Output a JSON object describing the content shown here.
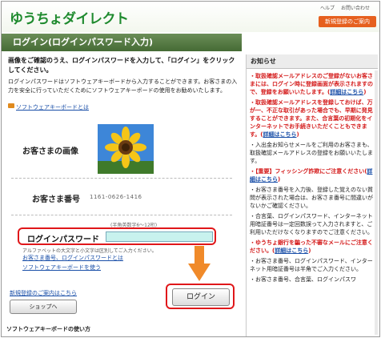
{
  "header": {
    "logo_text": "ゆうちょダイレクト",
    "util_links": [
      "ヘルプ",
      "お問い合わせ"
    ],
    "new_register": "新規登録のご案内"
  },
  "title": "ログイン(ログインパスワード入力)",
  "instructions": {
    "line1": "画像をご確認のうえ、ログインパスワードを入力して、「ログイン」をクリックしてください。",
    "line2": "ログインパスワードはソフトウェアキーボードから入力することができます。お客さまの入力を安全に行っていただくためにソフトウェアキーボードの使用をお勧めいたします。",
    "kb_link": "ソフトウェアキーボードとは"
  },
  "form": {
    "image_label": "お客さまの画像",
    "number_label": "お客さま番号",
    "number_value": "1161-0626-1416",
    "hint": "(半角英数字6〜12桁)",
    "password_label": "ログインパスワード",
    "note": "アルファベットの大文字と小文字は区別してご入力ください。",
    "forgot_link": "お客さま番号、ログインパスワードとは",
    "kb_use_link": "ソフトウェアキーボードを使う",
    "login_button": "ログイン"
  },
  "bottom": {
    "new_link": "新規登録のご案内はこちら",
    "shop_button": "ショップへ",
    "kb_howto": "ソフトウェアキーボードの使い方"
  },
  "sidebar": {
    "title": "お知らせ",
    "items": [
      {
        "text": "取扱確認メールアドレスのご登録がないお客さまには、ログイン時に登録画面が表示されますので、登録をお願いいたします。(",
        "more": "詳細はこちら",
        "tail": ")",
        "style": "red"
      },
      {
        "text": "取扱確認メールアドレスを登録しておけば、万が一、不正な取引があった場合でも、早期に発見することができます。また、合言葉の初期化をインターネットでお手続きいただくこともできます。(",
        "more": "詳細はこちら",
        "tail": ")",
        "style": "red"
      },
      {
        "text": "入出金お知らせメールをご利用のお客さまも、取扱確認メールアドレスの登録をお願いいたします。",
        "more": "",
        "tail": "",
        "style": "blk"
      },
      {
        "text": "【重要】フィッシング詐欺にご注意ください(",
        "more": "詳細はこちら",
        "tail": ")",
        "style": "red"
      },
      {
        "text": "お客さま番号を入力後、登録した覚えのない質問が表示された場合は、お客さま番号に間違いがないかご確認ください。",
        "more": "",
        "tail": "",
        "style": "blk"
      },
      {
        "text": "合言葉、ログインパスワード、インターネット用暗証番号は一定回数誤って入力されますと、ご利用いただけなくなりますのでご注意ください。",
        "more": "",
        "tail": "",
        "style": "blk"
      },
      {
        "text": "ゆうちょ銀行を騙った不審なメールにご注意ください。(",
        "more": "詳細はこちら",
        "tail": ")",
        "style": "red"
      },
      {
        "text": "お客さま番号、ログインパスワード、インターネット用暗証番号は半角でご入力ください。",
        "more": "",
        "tail": "",
        "style": "blk"
      },
      {
        "text": "お客さま番号、合言葉、ログインパスワ",
        "more": "",
        "tail": "",
        "style": "blk"
      }
    ]
  },
  "colors": {
    "brand_green": "#1e8a2e",
    "accent_orange": "#e6601e",
    "highlight_red": "#e0171a"
  }
}
